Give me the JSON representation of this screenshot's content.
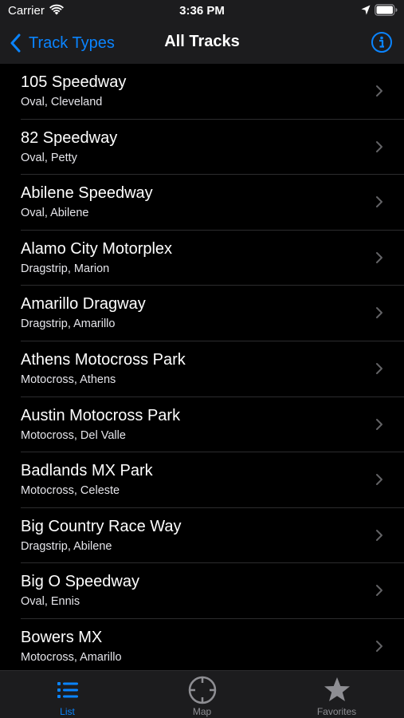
{
  "status_bar": {
    "carrier": "Carrier",
    "time": "3:36 PM"
  },
  "nav": {
    "back_label": "Track Types",
    "title": "All Tracks"
  },
  "tracks": [
    {
      "name": "105 Speedway",
      "detail": "Oval, Cleveland"
    },
    {
      "name": "82 Speedway",
      "detail": "Oval, Petty"
    },
    {
      "name": "Abilene Speedway",
      "detail": "Oval, Abilene"
    },
    {
      "name": "Alamo City Motorplex",
      "detail": "Dragstrip, Marion"
    },
    {
      "name": "Amarillo Dragway",
      "detail": "Dragstrip, Amarillo"
    },
    {
      "name": "Athens Motocross Park",
      "detail": "Motocross, Athens"
    },
    {
      "name": "Austin Motocross Park",
      "detail": "Motocross, Del Valle"
    },
    {
      "name": "Badlands MX Park",
      "detail": "Motocross, Celeste"
    },
    {
      "name": "Big Country Race Way",
      "detail": "Dragstrip, Abilene"
    },
    {
      "name": "Big O Speedway",
      "detail": "Oval, Ennis"
    },
    {
      "name": "Bowers MX",
      "detail": "Motocross, Amarillo"
    }
  ],
  "tabs": {
    "list": "List",
    "map": "Map",
    "favorites": "Favorites"
  },
  "colors": {
    "accent": "#0a84ff",
    "inactive": "#8e8e93",
    "bar_background": "#1c1c1e",
    "background": "#000000"
  },
  "icons": {
    "back": "chevron-left-icon",
    "info": "info-circle-icon",
    "row": "chevron-right-icon",
    "tab_list": "list-icon",
    "tab_map": "crosshair-icon",
    "tab_favorites": "star-icon"
  }
}
